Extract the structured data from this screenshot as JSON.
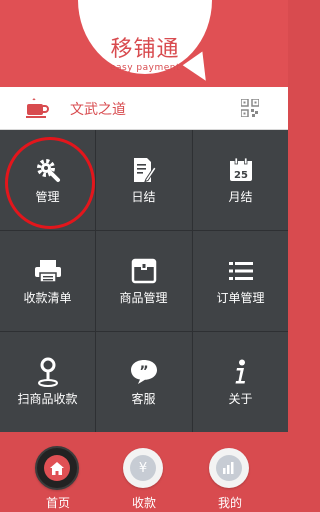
{
  "header": {
    "logo_title": "移铺通",
    "logo_subtitle": "easy payment"
  },
  "shop": {
    "name": "文武之道",
    "cup_icon": "coffee-cup-icon",
    "qr_icon": "qr-code-icon"
  },
  "menu": {
    "items": [
      {
        "label": "管理",
        "icon": "settings-gear-wrench-icon"
      },
      {
        "label": "日结",
        "icon": "daily-report-icon"
      },
      {
        "label": "月结",
        "icon": "calendar-25-icon",
        "calendar_day": "25"
      },
      {
        "label": "收款清单",
        "icon": "printer-icon"
      },
      {
        "label": "商品管理",
        "icon": "package-box-icon"
      },
      {
        "label": "订单管理",
        "icon": "list-icon"
      },
      {
        "label": "扫商品收款",
        "icon": "location-pin-icon"
      },
      {
        "label": "客服",
        "icon": "chat-bubble-quote-icon"
      },
      {
        "label": "关于",
        "icon": "info-icon"
      }
    ]
  },
  "tabbar": {
    "tabs": [
      {
        "label": "首页",
        "icon": "home-icon",
        "active": true
      },
      {
        "label": "收款",
        "icon": "yen-icon",
        "glyph": "¥"
      },
      {
        "label": "我的",
        "icon": "bar-chart-icon"
      }
    ]
  },
  "colors": {
    "brand_red": "#d84b4f",
    "grid_bg": "#404346",
    "highlight_circle": "#e3161c"
  }
}
